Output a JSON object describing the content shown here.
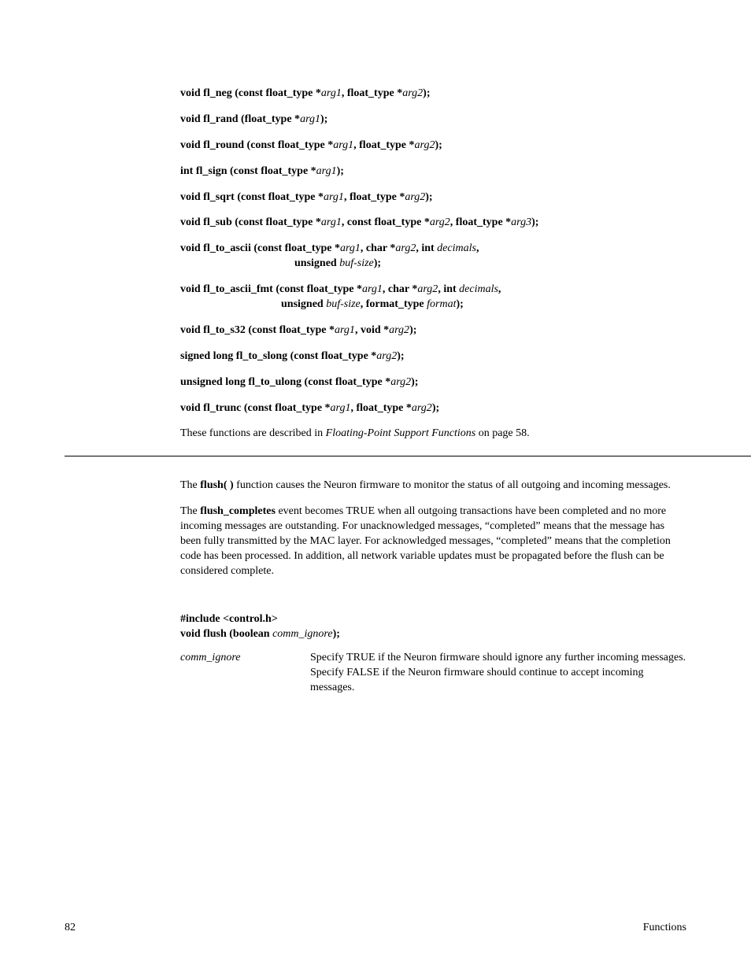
{
  "signatures": {
    "fl_neg": {
      "prefix": "void fl_neg (const float_type *",
      "a1": "arg1",
      "mid": ", float_type *",
      "a2": "arg2",
      "suffix": ");"
    },
    "fl_rand": {
      "prefix": "void fl_rand (float_type *",
      "a1": "arg1",
      "suffix": ");"
    },
    "fl_round": {
      "prefix": "void fl_round (const float_type *",
      "a1": "arg1",
      "mid": ", float_type *",
      "a2": "arg2",
      "suffix": ");"
    },
    "fl_sign": {
      "prefix": "int fl_sign (const float_type *",
      "a1": "arg1",
      "suffix": ");"
    },
    "fl_sqrt": {
      "prefix": "void fl_sqrt (const float_type *",
      "a1": "arg1",
      "mid": ", float_type *",
      "a2": "arg2",
      "suffix": ");"
    },
    "fl_sub": {
      "prefix": "void fl_sub (const float_type *",
      "a1": "arg1",
      "mid1": ", const float_type *",
      "a2": "arg2",
      "mid2": ", float_type *",
      "a3": "arg3",
      "suffix": ");"
    },
    "fl_to_ascii": {
      "prefix": "void fl_to_ascii (const float_type *",
      "a1": "arg1",
      "mid1": ", char *",
      "a2": "arg2",
      "mid2": ", int ",
      "a3": "decimals",
      "suffix1": ",",
      "line2_prefix": "unsigned ",
      "a4": "buf-size",
      "suffix2": ");"
    },
    "fl_to_ascii_fmt": {
      "prefix": "void fl_to_ascii_fmt (const float_type *",
      "a1": "arg1",
      "mid1": ",  char *",
      "a2": "arg2",
      "mid2": ",  int ",
      "a3": "decimals",
      "suffix1": ",",
      "line2_prefix": "unsigned ",
      "a4": "buf-size",
      "mid3": ",  format_type ",
      "a5": "format",
      "suffix2": ");"
    },
    "fl_to_s32": {
      "prefix": "void fl_to_s32 (const float_type *",
      "a1": "arg1",
      "mid": ", void *",
      "a2": "arg2",
      "suffix": ");"
    },
    "fl_to_slong": {
      "prefix": "signed long fl_to_slong (const float_type *",
      "a1": "arg2",
      "suffix": ");"
    },
    "fl_to_ulong": {
      "prefix": "unsigned long fl_to_ulong (const float_type *",
      "a1": "arg2",
      "suffix": ");"
    },
    "fl_trunc": {
      "prefix": "void fl_trunc (const float_type *",
      "a1": "arg1",
      "mid": ", float_type *",
      "a2": "arg2",
      "suffix": ");"
    }
  },
  "desc_line": {
    "pre": "These functions are described in ",
    "link": "Floating-Point Support Functions",
    "post": " on page 58."
  },
  "flush": {
    "p1": {
      "pre": "The ",
      "bold": "flush( )",
      "post": " function causes the Neuron firmware to monitor the status of all outgoing and incoming messages."
    },
    "p2": {
      "pre": "The ",
      "bold": "flush_completes",
      "post": " event becomes TRUE when all outgoing transactions have been completed and no more incoming messages are outstanding.  For unacknowledged messages, “completed” means that the message has been fully transmitted by the MAC layer.  For acknowledged messages, “completed” means that the completion code has been processed.  In addition, all network variable updates must be propagated before the flush can be considered complete."
    },
    "syntax": {
      "include": "#include <control.h>",
      "proto_pre": "void flush (boolean ",
      "proto_arg": "comm_ignore",
      "proto_suf": ");"
    },
    "param": {
      "term": "comm_ignore",
      "desc": "Specify TRUE if the Neuron firmware should ignore any further incoming messages.  Specify FALSE if the Neuron firmware should continue to accept incoming messages."
    }
  },
  "footer": {
    "page": "82",
    "section": "Functions"
  }
}
